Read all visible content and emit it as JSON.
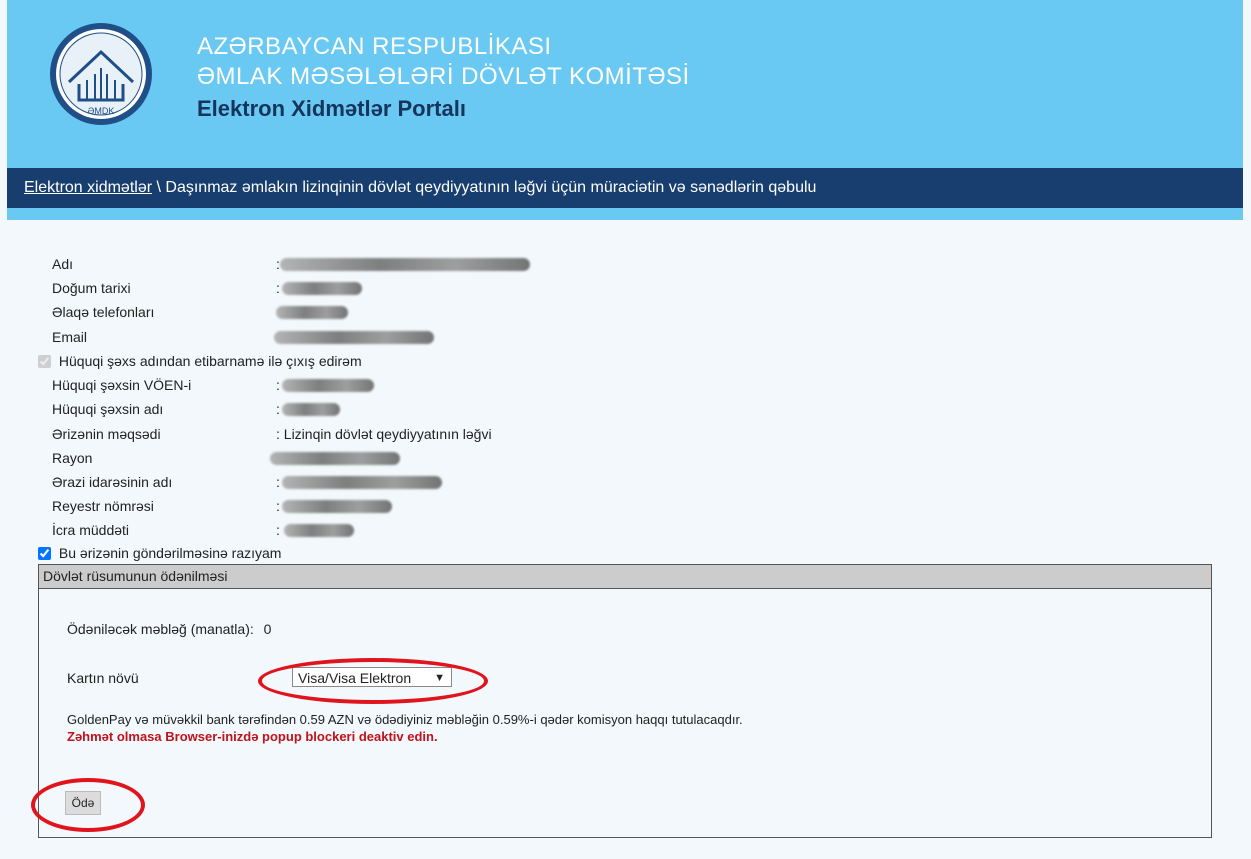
{
  "header": {
    "line1": "AZƏRBAYCAN RESPUBLİKASI",
    "line2": "ƏMLAK MƏSƏLƏLƏRİ DÖVLƏT KOMİTƏSİ",
    "line3": "Elektron Xidmətlər Portalı",
    "logo_text": "ƏMDK"
  },
  "breadcrumb": {
    "link": "Elektron xidmətlər",
    "separator": " \\ ",
    "current": "Daşınmaz əmlakın lizinqinin dövlət qeydiyyatının ləğvi üçün müraciətin və sənədlərin qəbulu"
  },
  "fields": {
    "adi": "Adı",
    "dogum": "Doğum tarixi",
    "elaqe": "Əlaqə telefonları",
    "email": "Email",
    "huquqi_checkbox": "Hüquqi şəxs adından etibarnamə ilə çıxış edirəm",
    "voen": "Hüquqi şəxsin VÖEN-i",
    "huquqi_adi": "Hüquqi şəxsin adı",
    "meqsed": "Ərizənin məqsədi",
    "meqsed_value": ": Lizinqin dövlət qeydiyyatının ləğvi",
    "rayon": "Rayon",
    "erazi": "Ərazi idarəsinin adı",
    "reyestr": "Reyestr nömrəsi",
    "icra": "İcra müddəti",
    "colon": ":",
    "razi_checkbox": "Bu ərizənin göndərilməsinə razıyam"
  },
  "payment": {
    "title": "Dövlət rüsumunun ödənilməsi",
    "amount_label": "Ödəniləcək məbləğ (manatla):",
    "amount_value": "0",
    "card_label": "Kartın növü",
    "card_selected": "Visa/Visa Elektron",
    "info": "GoldenPay və müvəkkil bank tərəfindən 0.59 AZN və ödədiyiniz məbləğin 0.59%-i qədər komisyon haqqı tutulacaqdır.",
    "warning": "Zəhmət olmasa Browser-inizdə popup blockeri deaktiv edin.",
    "pay_button": "Ödə"
  },
  "colors": {
    "header_bg": "#69c9f2",
    "breadcrumb_bg": "#173e6e",
    "warning": "#c0121b",
    "annotation": "#e1141d"
  }
}
